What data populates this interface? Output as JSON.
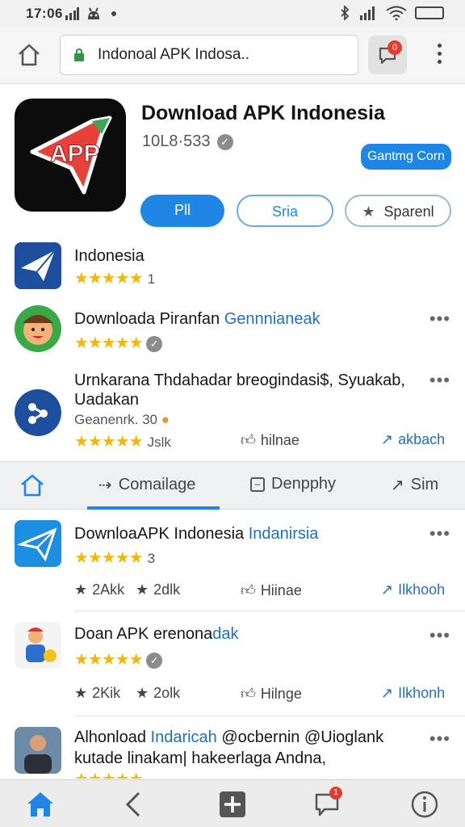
{
  "status": {
    "time": "17:06",
    "battery": "☐"
  },
  "browser": {
    "url": "Indonoal APK Indosa..",
    "notif_count": "0"
  },
  "header": {
    "title": "Download APK Indonesia",
    "subtitle": "10L8·533",
    "badge_label": "Gantmg Corn",
    "icon_text": "APP",
    "buttons": {
      "primary": "Pll",
      "secondary": "Sria",
      "tertiary": "Sparenl"
    }
  },
  "list_top": [
    {
      "title": "Indonesia",
      "highlight": "",
      "stars": "★★★★★",
      "count": "1"
    },
    {
      "title": "Downloada Piranfan ",
      "highlight": "Gennnianeak",
      "stars": "★★★★★"
    },
    {
      "title_line1": "Urnkarana Thdahadar breogindasi$, Syuakab,",
      "title_line2": "Uadakan",
      "sub": "Geanenrk. 30",
      "stars": "★★★★★",
      "count": "Jslk",
      "like": "hilnae",
      "share": "akbach"
    }
  ],
  "tabs": [
    {
      "label": ""
    },
    {
      "label": "Comailage"
    },
    {
      "label": "Denpphy"
    },
    {
      "label": "Sim"
    }
  ],
  "list_bottom": [
    {
      "title": "DownloaAPK Indonesia ",
      "highlight": "Indanirsia",
      "stars": "★★★★★",
      "count": "3",
      "a1": "2Akk",
      "a2": "2dlk",
      "like": "Hiinae",
      "share": "Ilkhooh"
    },
    {
      "title": "Doan APK erenona",
      "highlight": "dak",
      "stars": "★★★★★",
      "a1": "2Kik",
      "a2": "2olk",
      "like": "Hilnge",
      "share": "Ilkhonh"
    },
    {
      "title": "Alhonload ",
      "highlight": "Indaricah",
      "title_rest": " @ocbernin @Uioglank",
      "line2": "kutade linakam| hakeerlaga Andna,",
      "stars": "★★★★★"
    }
  ],
  "bottom_nav": {
    "notif_count": "1"
  }
}
